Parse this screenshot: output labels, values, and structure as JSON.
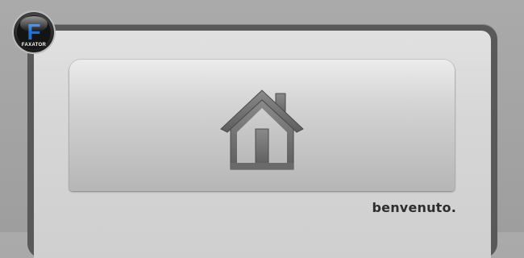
{
  "logo": {
    "letter": "F",
    "name": "FAXATOR"
  },
  "hero": {
    "icon": "home-icon"
  },
  "welcome": {
    "text": "benvenuto."
  },
  "colors": {
    "background": "#a4a4a4",
    "frame": "#595959",
    "panel": "#d8d8d8",
    "logo_blue": "#1f6fd6",
    "text": "#2e2e2e"
  }
}
